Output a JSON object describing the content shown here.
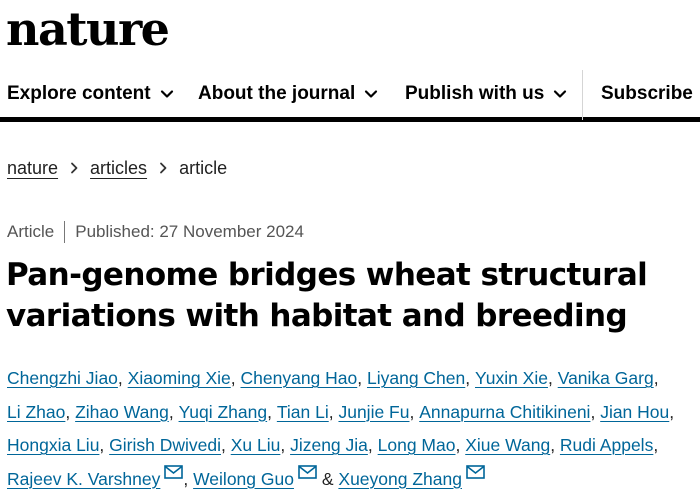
{
  "site": {
    "logo": "nature"
  },
  "nav": {
    "items": [
      {
        "label": "Explore content",
        "has_dropdown": true
      },
      {
        "label": "About the journal",
        "has_dropdown": true
      },
      {
        "label": "Publish with us",
        "has_dropdown": true
      },
      {
        "label": "Subscribe",
        "has_dropdown": false
      }
    ]
  },
  "breadcrumb": {
    "items": [
      "nature",
      "articles",
      "article"
    ]
  },
  "article": {
    "type": "Article",
    "published": "Published: 27 November 2024",
    "title": "Pan-genome bridges wheat structural variations with habitat and breeding",
    "authors": [
      "Chengzhi Jiao",
      "Xiaoming Xie",
      "Chenyang Hao",
      "Liyang Chen",
      "Yuxin Xie",
      "Vanika Garg",
      "Li Zhao",
      "Zihao Wang",
      "Yuqi Zhang",
      "Tian Li",
      "Junjie Fu",
      "Annapurna Chitikineni",
      "Jian Hou",
      "Hongxia Liu",
      "Girish Dwivedi",
      "Xu Liu",
      "Jizeng Jia",
      "Long Mao",
      "Xiue Wang",
      "Rudi Appels",
      "Rajeev K. Varshney",
      "Weilong Guo",
      "Xueyong Zhang"
    ],
    "separator": ", ",
    "last_joiner": "&"
  },
  "colors": {
    "link": "#006699",
    "text": "#222222",
    "rule": "#000000"
  }
}
